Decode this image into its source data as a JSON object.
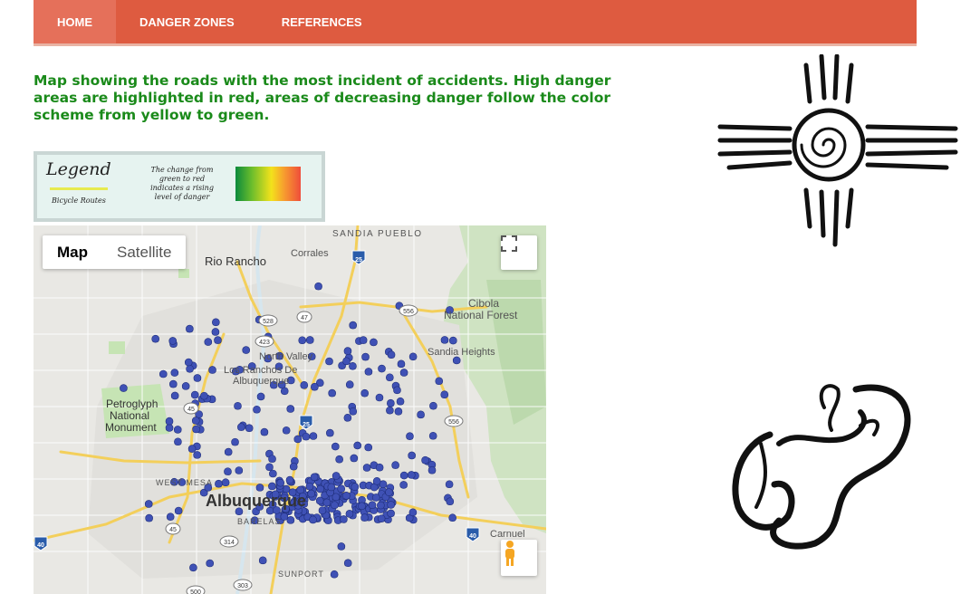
{
  "nav": {
    "items": [
      {
        "label": "HOME",
        "active": true
      },
      {
        "label": "DANGER ZONES",
        "active": false
      },
      {
        "label": "REFERENCES",
        "active": false
      }
    ]
  },
  "intro": {
    "text": "Map showing the roads with the most incident of accidents. High danger areas are highlighted in red, areas of decreasing danger follow the color scheme from yellow to green."
  },
  "legend": {
    "title": "Legend",
    "route_label": "Bicycle Routes",
    "description": "The change from green to red indicates a rising level of danger"
  },
  "map": {
    "type_buttons": {
      "map": "Map",
      "satellite": "Satellite"
    },
    "places": {
      "sandia_pueblo": "SANDIA PUEBLO",
      "rio_rancho": "Rio Rancho",
      "corrales": "Corrales",
      "cibola_1": "Cibola",
      "cibola_2": "National Forest",
      "sandia_heights": "Sandia Heights",
      "north_valley": "North Valley",
      "los_ranchos_1": "Los Ranchos De",
      "los_ranchos_2": "Albuquerque",
      "petroglyph_1": "Petroglyph",
      "petroglyph_2": "National",
      "petroglyph_3": "Monument",
      "west_mesa": "WEST MESA",
      "albuquerque": "Albuquerque",
      "barelas": "BARELAS",
      "carnuel": "Carnuel",
      "sunport": "SUNPORT"
    },
    "shields": {
      "i25_top": "25",
      "i25_mid": "25",
      "i40_left": "40",
      "i40_right": "40",
      "r556_top": "556",
      "r556_mid": "556",
      "r528": "528",
      "r47": "47",
      "r423": "423",
      "r45_top": "45",
      "r45_bot": "45",
      "r314": "314",
      "r303": "303",
      "r500": "500"
    },
    "colors": {
      "marker": "#3f51b5",
      "highway": "#f3cf5b",
      "park": "#c6e4b4"
    }
  }
}
